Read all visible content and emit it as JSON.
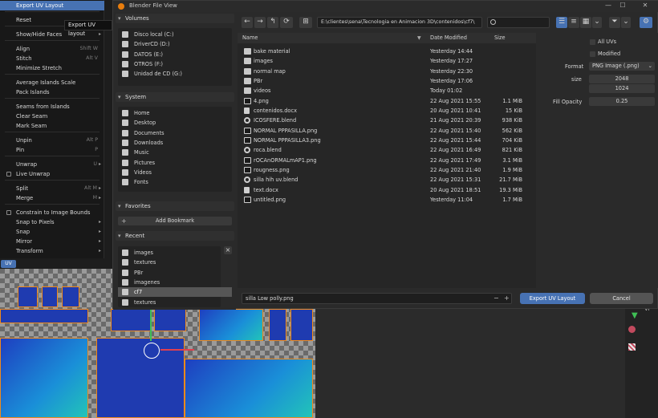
{
  "window": {
    "title": "Blender File View",
    "controls": [
      "—",
      "☐",
      "✕"
    ]
  },
  "uv_menu": {
    "tooltip": "Export UV layout",
    "editor_tab": "UV",
    "items": [
      {
        "label": "Export UV Layout",
        "shortcut": "",
        "submenu": false,
        "active": true
      },
      {
        "label": "Reset",
        "shortcut": "",
        "submenu": false
      },
      {
        "label": "Show/Hide Faces",
        "shortcut": "",
        "submenu": true
      },
      {
        "label": "Align",
        "shortcut": "Shift W",
        "submenu": false
      },
      {
        "label": "Stitch",
        "shortcut": "Alt V",
        "submenu": false
      },
      {
        "label": "Minimize Stretch",
        "shortcut": "",
        "submenu": false
      },
      {
        "label": "Average Islands Scale",
        "shortcut": "",
        "submenu": false
      },
      {
        "label": "Pack Islands",
        "shortcut": "",
        "submenu": false
      },
      {
        "label": "Seams from Islands",
        "shortcut": "",
        "submenu": false
      },
      {
        "label": "Clear Seam",
        "shortcut": "",
        "submenu": false
      },
      {
        "label": "Mark Seam",
        "shortcut": "",
        "submenu": false
      },
      {
        "label": "Unpin",
        "shortcut": "Alt P",
        "submenu": false
      },
      {
        "label": "Pin",
        "shortcut": "P",
        "submenu": false
      },
      {
        "label": "Unwrap",
        "shortcut": "U",
        "submenu": true
      },
      {
        "label": "Live Unwrap",
        "shortcut": "",
        "submenu": false,
        "checkbox": true
      },
      {
        "label": "Split",
        "shortcut": "Alt M",
        "submenu": true
      },
      {
        "label": "Merge",
        "shortcut": "M",
        "submenu": true
      },
      {
        "label": "Constrain to Image Bounds",
        "shortcut": "",
        "submenu": false,
        "checkbox": true
      },
      {
        "label": "Snap to Pixels",
        "shortcut": "",
        "submenu": true
      },
      {
        "label": "Snap",
        "shortcut": "",
        "submenu": true
      },
      {
        "label": "Mirror",
        "shortcut": "",
        "submenu": true
      },
      {
        "label": "Transform",
        "shortcut": "",
        "submenu": true
      }
    ]
  },
  "sidebar": {
    "volumes_title": "Volumes",
    "volumes": [
      {
        "label": "Disco local (C:)",
        "icon": "drive-icon"
      },
      {
        "label": "DriverCD (D:)",
        "icon": "drive-icon"
      },
      {
        "label": "DATOS (E:)",
        "icon": "drive-icon"
      },
      {
        "label": "OTROS (F:)",
        "icon": "drive-icon"
      },
      {
        "label": "Unidad de CD (G:)",
        "icon": "disc-icon"
      }
    ],
    "system_title": "System",
    "system": [
      {
        "label": "Home",
        "icon": "home-icon"
      },
      {
        "label": "Desktop",
        "icon": "desktop-icon"
      },
      {
        "label": "Documents",
        "icon": "documents-icon"
      },
      {
        "label": "Downloads",
        "icon": "download-icon"
      },
      {
        "label": "Music",
        "icon": "music-icon"
      },
      {
        "label": "Pictures",
        "icon": "pictures-icon"
      },
      {
        "label": "Videos",
        "icon": "video-icon"
      },
      {
        "label": "Fonts",
        "icon": "font-icon"
      }
    ],
    "favorites_title": "Favorites",
    "add_bookmark": "Add Bookmark",
    "recent_title": "Recent",
    "recent": [
      {
        "label": "images",
        "selected": false
      },
      {
        "label": "textures",
        "selected": false
      },
      {
        "label": "PBr",
        "selected": false
      },
      {
        "label": "imagenes",
        "selected": false
      },
      {
        "label": "cf7",
        "selected": true
      },
      {
        "label": "textures",
        "selected": false
      }
    ]
  },
  "toolbar": {
    "path": "E:\\clientes\\sena\\Tecnologia en Animacion 3D\\contenidos\\cf7\\",
    "search_placeholder": ""
  },
  "file_list": {
    "columns": {
      "name": "Name",
      "date": "Date Modified",
      "size": "Size"
    },
    "rows": [
      {
        "name": "bake material",
        "date": "Yesterday 14:44",
        "size": "",
        "type": "folder"
      },
      {
        "name": "images",
        "date": "Yesterday 17:27",
        "size": "",
        "type": "folder"
      },
      {
        "name": "normal map",
        "date": "Yesterday 22:30",
        "size": "",
        "type": "folder"
      },
      {
        "name": "PBr",
        "date": "Yesterday 17:06",
        "size": "",
        "type": "folder"
      },
      {
        "name": "videos",
        "date": "Today 01:02",
        "size": "",
        "type": "folder"
      },
      {
        "name": "4.png",
        "date": "22 Aug 2021 15:55",
        "size": "1.1 MiB",
        "type": "image"
      },
      {
        "name": "contenidos.docx",
        "date": "20 Aug 2021 10:41",
        "size": "15 KiB",
        "type": "text"
      },
      {
        "name": "ICOSFERE.blend",
        "date": "21 Aug 2021 20:39",
        "size": "938 KiB",
        "type": "blend"
      },
      {
        "name": "NORMAL PPPASILLA.png",
        "date": "22 Aug 2021 15:40",
        "size": "562 KiB",
        "type": "image"
      },
      {
        "name": "NORMAL PPPASILLA3.png",
        "date": "22 Aug 2021 15:44",
        "size": "704 KiB",
        "type": "image"
      },
      {
        "name": "roca.blend",
        "date": "22 Aug 2021 16:49",
        "size": "821 KiB",
        "type": "blend"
      },
      {
        "name": "rOCAnORMALmAP1.png",
        "date": "22 Aug 2021 17:49",
        "size": "3.1 MiB",
        "type": "image"
      },
      {
        "name": "rougness.png",
        "date": "22 Aug 2021 21:40",
        "size": "1.9 MiB",
        "type": "image"
      },
      {
        "name": "silla hih uv.blend",
        "date": "22 Aug 2021 15:31",
        "size": "21.7 MiB",
        "type": "blend"
      },
      {
        "name": "text.docx",
        "date": "20 Aug 2021 18:51",
        "size": "19.3 MiB",
        "type": "text"
      },
      {
        "name": "untitled.png",
        "date": "Yesterday 11:04",
        "size": "1.7 MiB",
        "type": "image"
      }
    ]
  },
  "options": {
    "all_uvs": "All UVs",
    "modified": "Modified",
    "format_label": "Format",
    "format_value": "PNG Image (.png)",
    "size_label": "size",
    "size_x": "2048",
    "size_y": "1024",
    "fill_opacity_label": "Fill Opacity",
    "fill_opacity_value": "0.25"
  },
  "footer": {
    "filename": "silla Low polly.png",
    "minus": "−",
    "plus": "+",
    "export_label": "Export UV Layout",
    "cancel_label": "Cancel"
  },
  "viewport_label": "Vi",
  "colors": {
    "accent": "#4772b3",
    "uv_island": "#1f3bb0",
    "uv_edge": "#f08a1a"
  }
}
